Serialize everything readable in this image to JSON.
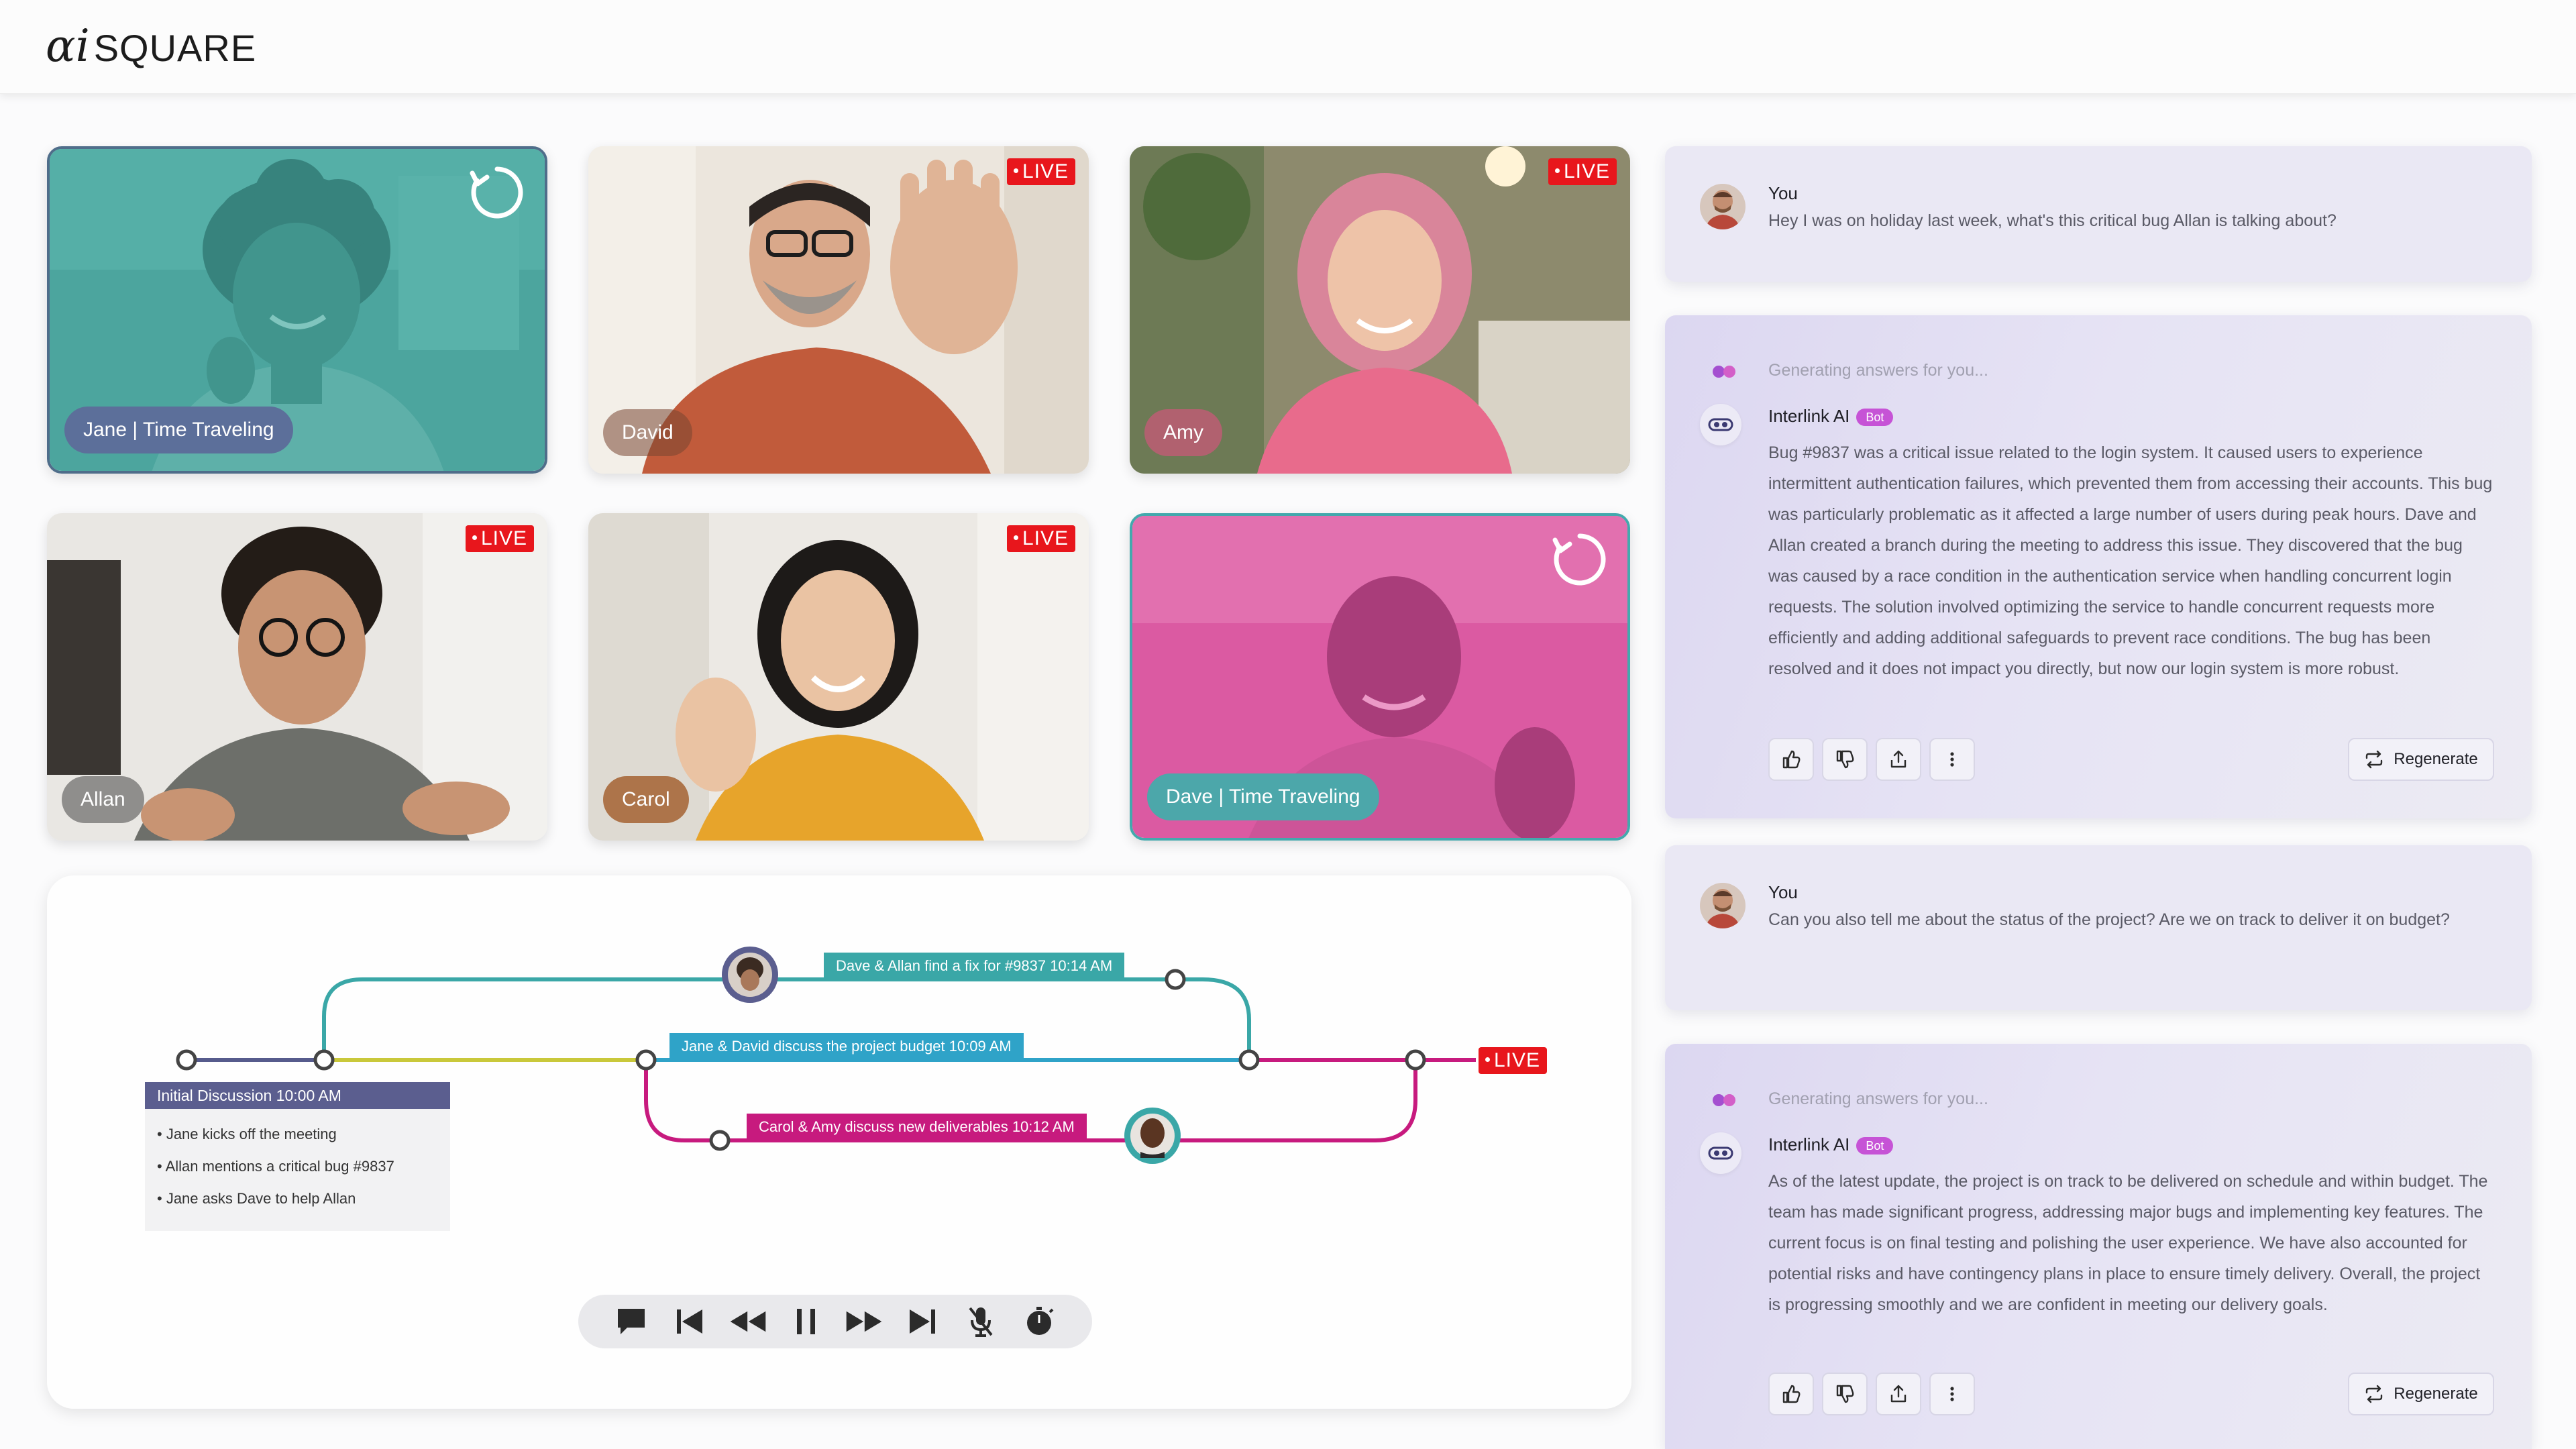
{
  "app": {
    "logo_ai": "αi",
    "logo_square": "SQUARE"
  },
  "tiles": [
    {
      "name": "Jane | Time Traveling",
      "live": false,
      "time_traveling": true
    },
    {
      "name": "David",
      "live": true
    },
    {
      "name": "Amy",
      "live": true
    },
    {
      "name": "Allan",
      "live": true
    },
    {
      "name": "Carol",
      "live": true
    },
    {
      "name": "Dave | Time Traveling",
      "live": false,
      "time_traveling": true
    }
  ],
  "live_label": "LIVE",
  "timeline": {
    "events": {
      "fix": "Dave & Allan find a fix for #9837 10:14 AM",
      "budget": "Jane & David discuss the project budget 10:09 AM",
      "deliverables": "Carol & Amy discuss new deliverables 10:12 AM"
    },
    "live_label": "LIVE",
    "initial": {
      "title": "Initial Discussion 10:00 AM",
      "items": [
        "• Jane kicks off the meeting",
        "• Allan mentions a critical bug #9837",
        "• Jane asks Dave to help Allan"
      ]
    },
    "colors": {
      "teal": "#3aa7a7",
      "navy": "#565b8c",
      "olive": "#c9c83a",
      "blue": "#2fa3c8",
      "magenta": "#c71a7e",
      "red": "#e8161c"
    }
  },
  "controls": [
    {
      "icon": "chat-icon"
    },
    {
      "icon": "skip-back-icon"
    },
    {
      "icon": "rewind-icon"
    },
    {
      "icon": "pause-icon"
    },
    {
      "icon": "fast-forward-icon"
    },
    {
      "icon": "skip-forward-icon"
    },
    {
      "icon": "mic-off-icon"
    },
    {
      "icon": "timer-icon"
    }
  ],
  "chat": {
    "messages": [
      {
        "role": "user",
        "name": "You",
        "text": "Hey I was on holiday last week, what's this critical bug Allan is talking about?"
      },
      {
        "role": "ai",
        "status": "Generating answers for you...",
        "name": "Interlink AI",
        "badge": "Bot",
        "text": "Bug #9837 was a critical issue related to the login system. It caused users to experience intermittent authentication failures, which prevented them from accessing their accounts. This bug was particularly problematic as it affected a large number of users during peak hours. Dave and Allan created a branch during the meeting to address this issue. They discovered that the bug was caused by a race condition in the authentication service when handling concurrent login requests. The solution involved optimizing the service to handle concurrent requests more efficiently and adding additional safeguards to prevent race conditions. The bug has been resolved and it does not impact you directly, but now our login system is more robust.",
        "regenerate": "Regenerate"
      },
      {
        "role": "user",
        "name": "You",
        "text": "Can you also tell me about the status of the project? Are we on track to deliver it on budget?"
      },
      {
        "role": "ai",
        "status": "Generating answers for you...",
        "name": "Interlink AI",
        "badge": "Bot",
        "text": "As of the latest update, the project is on track to be delivered on schedule and within budget. The team has made significant progress, addressing major bugs and implementing key features. The current focus is on final testing and polishing the user experience. We have also accounted for potential risks and have contingency plans in place to ensure timely delivery. Overall, the project is progressing smoothly and we are confident in meeting our delivery goals.",
        "regenerate": "Regenerate"
      }
    ]
  }
}
